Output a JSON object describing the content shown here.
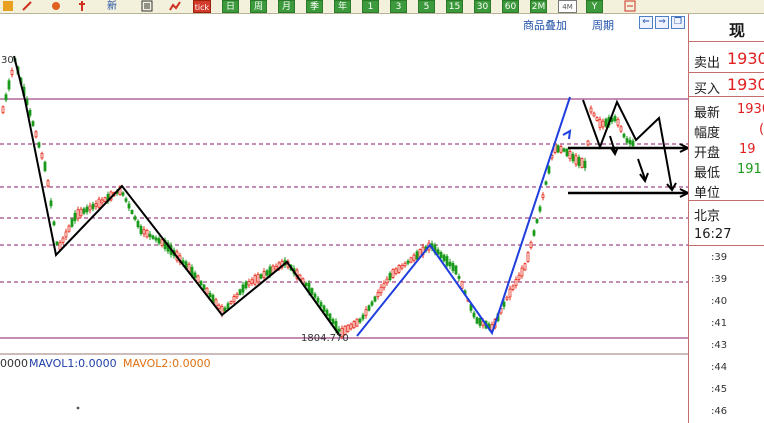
{
  "toolbar": {
    "icons": [
      "grid-icon",
      "tools-icon",
      "pencil-icon",
      "pin-icon"
    ],
    "new_label": "新",
    "list_icon": "list-icon",
    "chart_icon": "chart-icon",
    "tick_label": "tick",
    "periods": [
      "日",
      "周",
      "月",
      "季",
      "年",
      "1",
      "3",
      "5",
      "15",
      "30",
      "60"
    ],
    "min2_label": "2M",
    "min4_label": "4M",
    "y_label": "Y",
    "export_icon": "export-icon"
  },
  "chart_header": {
    "overlay_label": "商品叠加",
    "period_label": "周期"
  },
  "chart": {
    "left_price_label": "30",
    "low_label": "1804.770",
    "volume_label_0": "0000",
    "volume_label_1": "MAVOL1:0.0000",
    "volume_label_2": "MAVOL2:0.0000",
    "colors": {
      "up": "#e62c1c",
      "down": "#1a9a1a",
      "black_trend": "#000000",
      "blue_trend": "#1f3ee0",
      "guide": "#8b1a6a"
    }
  },
  "panel": {
    "title": "现",
    "sell_label": "卖出",
    "sell_value": "1930",
    "buy_label": "买入",
    "buy_value": "1930",
    "latest_label": "最新",
    "latest_value": "1930",
    "range_label": "幅度",
    "range_value": "(",
    "open_label": "开盘",
    "open_value": "19",
    "low_label": "最低",
    "low_value": "191",
    "unit_label": "单位",
    "location": "北京",
    "time": "16:27",
    "ticks": [
      ":39",
      ":39",
      ":40",
      ":41",
      ":43",
      ":44",
      ":45",
      ":46"
    ]
  }
}
